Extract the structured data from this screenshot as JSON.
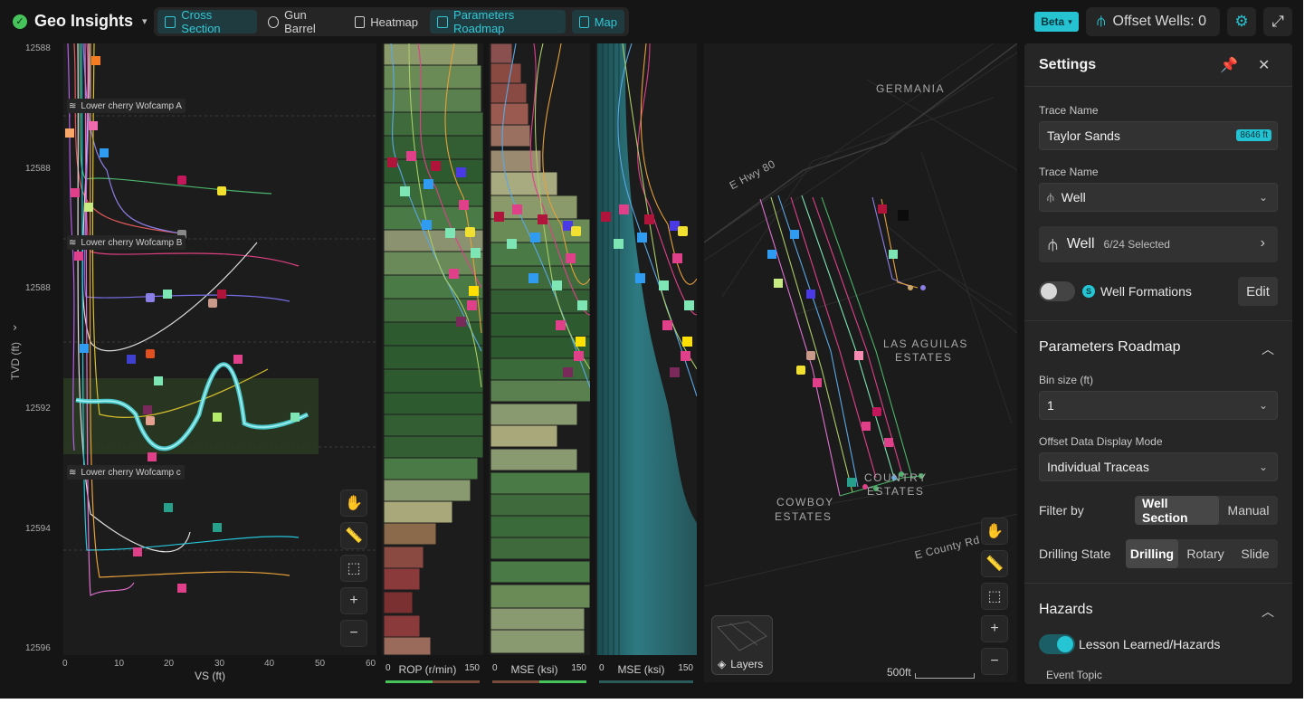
{
  "topbar": {
    "app_title": "Geo Insights",
    "tabs": [
      {
        "label": "Cross Section",
        "active": true
      },
      {
        "label": "Gun Barrel",
        "active": false
      },
      {
        "label": "Heatmap",
        "active": false
      },
      {
        "label": "Parameters Roadmap",
        "active": true
      },
      {
        "label": "Map",
        "active": true
      }
    ],
    "beta_label": "Beta",
    "offset_wells_label": "Offset Wells: 0"
  },
  "cross_section": {
    "y_axis_label": "TVD (ft)",
    "y_ticks": [
      "12588",
      "12588",
      "12588",
      "12592",
      "12594",
      "12596"
    ],
    "x_axis_label": "VS (ft)",
    "x_ticks": [
      "0",
      "10",
      "20",
      "30",
      "40",
      "50",
      "60"
    ],
    "formations": [
      "Lower cherry Wofcamp A",
      "Lower cherry Wofcamp B",
      "Lower cherry Wofcamp c"
    ]
  },
  "tracks": [
    {
      "label": "ROP (r/min)",
      "min": "0",
      "max": "150"
    },
    {
      "label": "MSE (ksi)",
      "min": "0",
      "max": "150"
    },
    {
      "label": "MSE (ksi)",
      "min": "0",
      "max": "150"
    }
  ],
  "map": {
    "labels": [
      "GERMANIA",
      "E Hwy 80",
      "LAS AGUILAS",
      "ESTATES",
      "COWBOY",
      "ESTATES",
      "COUNTRY",
      "ESTATES",
      "E County Rd"
    ],
    "layers_label": "Layers",
    "scale_label": "500ft"
  },
  "settings": {
    "title": "Settings",
    "trace_name_label": "Trace Name",
    "trace_name_value": "Taylor Sands",
    "trace_depth_badge": "8646 ft",
    "trace_name_label_2": "Trace Name",
    "trace_type_value": "Well",
    "well_selector_name": "Well",
    "well_selector_count": "6/24 Selected",
    "well_formations_label": "Well Formations",
    "well_formations_badge": "S",
    "edit_label": "Edit",
    "roadmap_title": "Parameters Roadmap",
    "bin_size_label": "Bin size (ft)",
    "bin_size_value": "1",
    "display_mode_label": "Offset Data Display Mode",
    "display_mode_value": "Individual Traceas",
    "filter_by_label": "Filter by",
    "filter_options": [
      "Well Section",
      "Manual"
    ],
    "drilling_state_label": "Drilling State",
    "drilling_options": [
      "Drilling",
      "Rotary",
      "Slide"
    ],
    "hazards_title": "Hazards",
    "hazards_toggle_label": "Lesson Learned/Hazards",
    "event_topic_label": "Event Topic"
  },
  "colors": {
    "accent": "#25c2d2",
    "background": "#151515",
    "panel": "#262626",
    "status_ok": "#46c35b"
  }
}
